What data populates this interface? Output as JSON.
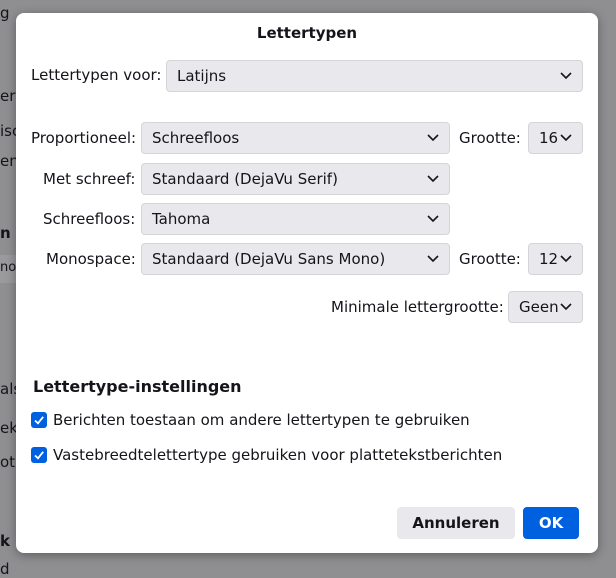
{
  "background": {
    "fragments": [
      "g",
      "er",
      "isc",
      "en",
      "n",
      "nor",
      "als",
      "ek",
      "ot",
      "k",
      "d"
    ]
  },
  "dialog": {
    "title": "Lettertypen",
    "fonts_for": {
      "label": "Lettertypen voor:",
      "value": "Latijns"
    },
    "proportional": {
      "label": "Proportioneel:",
      "value": "Schreefloos",
      "size_label": "Grootte:",
      "size_value": "16"
    },
    "serif": {
      "label": "Met schreef:",
      "value": "Standaard (DejaVu Serif)"
    },
    "sans_serif": {
      "label": "Schreefloos:",
      "value": "Tahoma"
    },
    "monospace": {
      "label": "Monospace:",
      "value": "Standaard (DejaVu Sans Mono)",
      "size_label": "Grootte:",
      "size_value": "12"
    },
    "minimum": {
      "label": "Minimale lettergrootte:",
      "value": "Geen"
    },
    "settings": {
      "title": "Lettertype-instellingen",
      "options": [
        {
          "label": "Berichten toestaan om andere lettertypen te gebruiken",
          "checked": true
        },
        {
          "label": "Vastebreedtelettertype gebruiken voor plattetekstberichten",
          "checked": true
        }
      ]
    },
    "buttons": {
      "cancel": "Annuleren",
      "ok": "OK"
    },
    "colors": {
      "accent": "#0061e0",
      "select_bg": "#e9e9ed",
      "backdrop": "#8f8f91"
    }
  }
}
